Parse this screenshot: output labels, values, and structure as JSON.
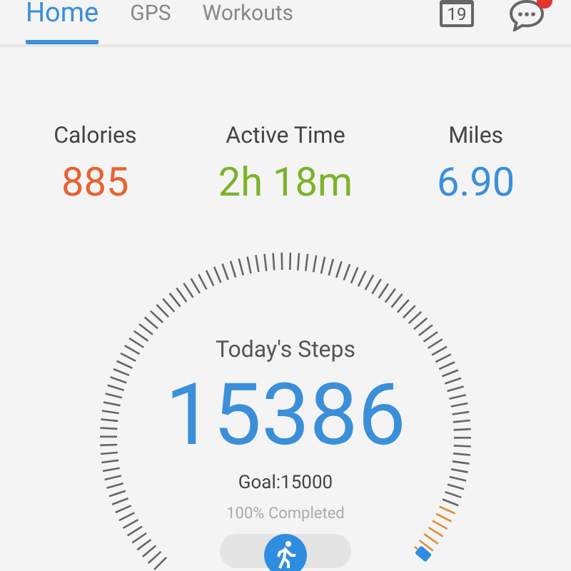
{
  "tabs": [
    {
      "label": "Home",
      "selected": true
    },
    {
      "label": "GPS",
      "selected": false
    },
    {
      "label": "Workouts",
      "selected": false
    }
  ],
  "header": {
    "calendar_day": "19",
    "messages_unread": true
  },
  "stats": [
    {
      "label": "Calories",
      "value": "885",
      "color": "#e8622f"
    },
    {
      "label": "Active Time",
      "value": "2h 18m",
      "color": "#7cb32a"
    },
    {
      "label": "Miles",
      "value": "6.90",
      "color": "#3b8fd9"
    }
  ],
  "steps": {
    "title": "Today's Steps",
    "count": "15386",
    "goal": "Goal:15000",
    "progress": "100% Completed"
  }
}
